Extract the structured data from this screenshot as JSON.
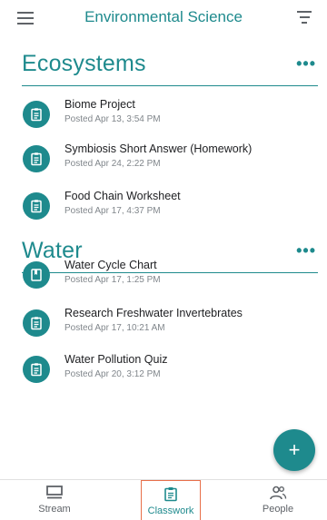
{
  "header": {
    "title": "Environmental Science",
    "menu_icon": "menu-icon",
    "filter_icon": "filter-icon"
  },
  "sections": [
    {
      "title": "Ecosystems",
      "more": "•••",
      "items": [
        {
          "title": "Biome Project",
          "posted": "Posted Apr 13, 3:54 PM",
          "icon": "assignment-icon"
        },
        {
          "title": "Symbiosis Short Answer (Homework)",
          "posted": "Posted Apr 24, 2:22 PM",
          "icon": "assignment-icon"
        },
        {
          "title": "Food Chain Worksheet",
          "posted": "Posted Apr 17, 4:37 PM",
          "icon": "assignment-icon"
        }
      ]
    },
    {
      "title": "Water",
      "more": "•••",
      "items": [
        {
          "title": "Water Cycle Chart",
          "posted": "Posted Apr 17, 1:25 PM",
          "icon": "material-icon"
        },
        {
          "title": "Research Freshwater Invertebrates",
          "posted": "Posted Apr 17, 10:21 AM",
          "icon": "assignment-icon"
        },
        {
          "title": "Water Pollution Quiz",
          "posted": "Posted Apr 20, 3:12 PM",
          "icon": "assignment-icon"
        }
      ]
    }
  ],
  "fab": {
    "symbol": "+"
  },
  "bottom_nav": [
    {
      "label": "Stream",
      "icon": "stream-icon"
    },
    {
      "label": "Classwork",
      "icon": "classwork-icon",
      "active": true
    },
    {
      "label": "People",
      "icon": "people-icon"
    }
  ],
  "colors": {
    "accent": "#1e8a8d",
    "active_outline": "#e8704a"
  }
}
